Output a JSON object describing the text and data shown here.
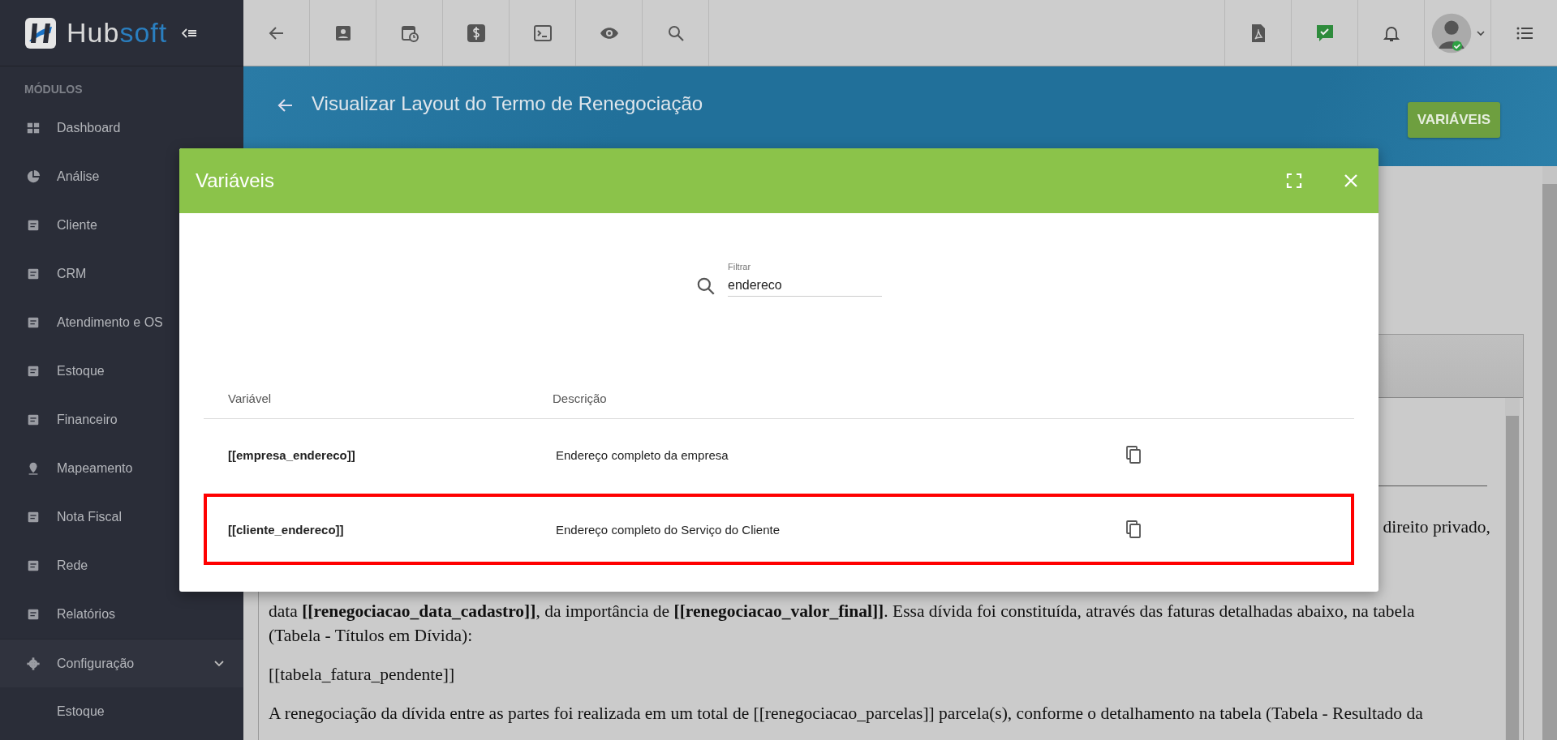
{
  "logo": {
    "parts": [
      "Hub",
      "soft"
    ]
  },
  "sidebar": {
    "section_label": "MÓDULOS",
    "items": [
      {
        "label": "Dashboard"
      },
      {
        "label": "Análise"
      },
      {
        "label": "Cliente"
      },
      {
        "label": "CRM"
      },
      {
        "label": "Atendimento e OS"
      },
      {
        "label": "Estoque"
      },
      {
        "label": "Financeiro"
      },
      {
        "label": "Mapeamento"
      },
      {
        "label": "Nota Fiscal"
      },
      {
        "label": "Rede"
      },
      {
        "label": "Relatórios"
      },
      {
        "label": "Configuração",
        "expanded": true,
        "children": [
          {
            "label": "Estoque"
          }
        ]
      }
    ]
  },
  "page_header": {
    "title": "Visualizar Layout do Termo de Renegociação",
    "button": "VARIÁVEIS"
  },
  "document": {
    "fragment": "direito privado,",
    "paragraphs": [
      {
        "lines": [
          "data **[[renegociacao_data_cadastro]]**, da importância de **[[renegociacao_valor_final]]**. Essa dívida foi constituída, através das faturas detalhadas abaixo, na tabela",
          "(Tabela - Títulos em Dívida):"
        ]
      },
      {
        "lines": [
          "[[tabela_fatura_pendente]]"
        ]
      },
      {
        "lines": [
          "A renegociação da dívida entre as partes foi realizada em um total de [[renegociacao_parcelas]] parcela(s), conforme o detalhamento na tabela (Tabela - Resultado da"
        ]
      }
    ]
  },
  "modal": {
    "title": "Variáveis",
    "filter": {
      "label": "Filtrar",
      "value": "endereco"
    },
    "columns": [
      "Variável",
      "Descrição"
    ],
    "rows": [
      {
        "variable": "[[empresa_endereco]]",
        "description": "Endereço completo da empresa",
        "highlighted": false
      },
      {
        "variable": "[[cliente_endereco]]",
        "description": "Endereço completo do Serviço do Cliente",
        "highlighted": true
      }
    ]
  }
}
